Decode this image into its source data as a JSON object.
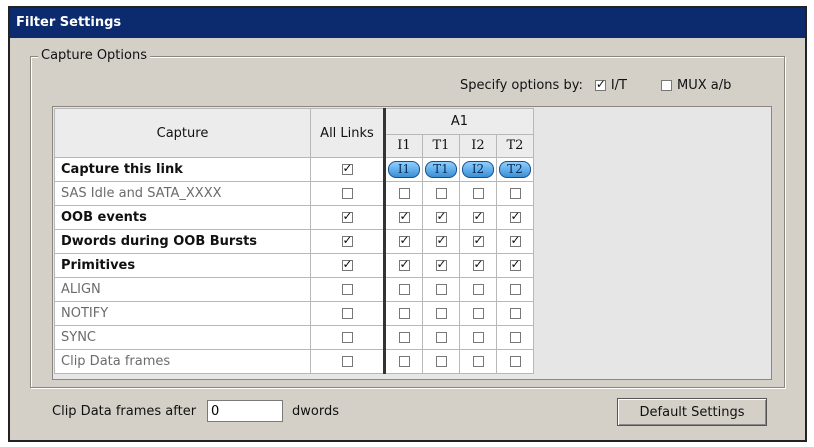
{
  "window": {
    "title": "Filter Settings"
  },
  "group": {
    "legend": "Capture Options"
  },
  "specify": {
    "label": "Specify options by:",
    "it": {
      "label": "I/T",
      "checked": true
    },
    "mux": {
      "label": "MUX a/b",
      "checked": false
    }
  },
  "table": {
    "header": {
      "capture": "Capture",
      "all_links": "All Links",
      "group": "A1",
      "sub": [
        "I1",
        "T1",
        "I2",
        "T2"
      ]
    },
    "rows": [
      {
        "label": "Capture this link",
        "style": "bold",
        "all": true,
        "cells": [
          "I1",
          "T1",
          "I2",
          "T2"
        ],
        "pill": true
      },
      {
        "label": "SAS Idle and SATA_XXXX",
        "style": "gray",
        "all": false,
        "cells": [
          false,
          false,
          false,
          false
        ]
      },
      {
        "label": "OOB events",
        "style": "bold",
        "all": true,
        "cells": [
          true,
          true,
          true,
          true
        ]
      },
      {
        "label": "Dwords during OOB Bursts",
        "style": "bold",
        "indent": true,
        "all": true,
        "cells": [
          true,
          true,
          true,
          true
        ]
      },
      {
        "label": "Primitives",
        "style": "bold",
        "all": true,
        "cells": [
          true,
          true,
          true,
          true
        ]
      },
      {
        "label": "ALIGN",
        "style": "gray",
        "indent": true,
        "all": false,
        "cells": [
          false,
          false,
          false,
          false
        ]
      },
      {
        "label": "NOTIFY",
        "style": "gray",
        "indent": true,
        "all": false,
        "cells": [
          false,
          false,
          false,
          false
        ]
      },
      {
        "label": "SYNC",
        "style": "gray",
        "indent": true,
        "all": false,
        "cells": [
          false,
          false,
          false,
          false
        ]
      },
      {
        "label": "Clip Data frames",
        "style": "gray",
        "all": false,
        "cells": [
          false,
          false,
          false,
          false
        ]
      }
    ]
  },
  "footer": {
    "clip_label": "Clip Data frames after",
    "clip_value": "0",
    "unit": "dwords",
    "default_button": "Default Settings"
  }
}
